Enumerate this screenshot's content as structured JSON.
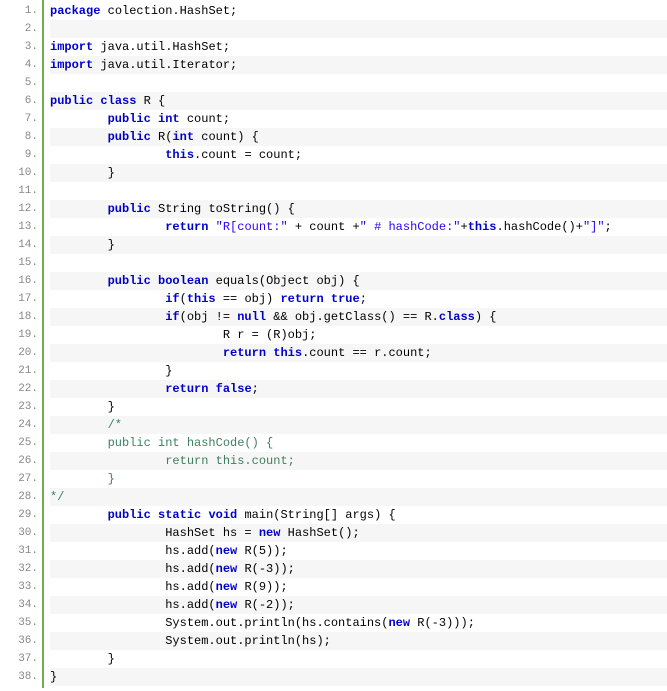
{
  "lines": [
    {
      "num": "1",
      "parts": [
        {
          "cls": "kw",
          "t": "package"
        },
        {
          "cls": "plain",
          "t": " colection.HashSet;"
        }
      ]
    },
    {
      "num": "2",
      "parts": []
    },
    {
      "num": "3",
      "parts": [
        {
          "cls": "kw",
          "t": "import"
        },
        {
          "cls": "plain",
          "t": " java.util.HashSet;"
        }
      ]
    },
    {
      "num": "4",
      "parts": [
        {
          "cls": "kw",
          "t": "import"
        },
        {
          "cls": "plain",
          "t": " java.util.Iterator;"
        }
      ]
    },
    {
      "num": "5",
      "parts": []
    },
    {
      "num": "6",
      "parts": [
        {
          "cls": "kw",
          "t": "public"
        },
        {
          "cls": "plain",
          "t": " "
        },
        {
          "cls": "kw",
          "t": "class"
        },
        {
          "cls": "plain",
          "t": " R {"
        }
      ]
    },
    {
      "num": "7",
      "parts": [
        {
          "cls": "plain",
          "t": "        "
        },
        {
          "cls": "kw",
          "t": "public"
        },
        {
          "cls": "plain",
          "t": " "
        },
        {
          "cls": "kw",
          "t": "int"
        },
        {
          "cls": "plain",
          "t": " count;"
        }
      ]
    },
    {
      "num": "8",
      "parts": [
        {
          "cls": "plain",
          "t": "        "
        },
        {
          "cls": "kw",
          "t": "public"
        },
        {
          "cls": "plain",
          "t": " R("
        },
        {
          "cls": "kw",
          "t": "int"
        },
        {
          "cls": "plain",
          "t": " count) {"
        }
      ]
    },
    {
      "num": "9",
      "parts": [
        {
          "cls": "plain",
          "t": "                "
        },
        {
          "cls": "kw",
          "t": "this"
        },
        {
          "cls": "plain",
          "t": ".count = count;"
        }
      ]
    },
    {
      "num": "10",
      "parts": [
        {
          "cls": "plain",
          "t": "        }"
        }
      ]
    },
    {
      "num": "11",
      "parts": []
    },
    {
      "num": "12",
      "parts": [
        {
          "cls": "plain",
          "t": "        "
        },
        {
          "cls": "kw",
          "t": "public"
        },
        {
          "cls": "plain",
          "t": " String toString() {"
        }
      ]
    },
    {
      "num": "13",
      "parts": [
        {
          "cls": "plain",
          "t": "                "
        },
        {
          "cls": "kw",
          "t": "return"
        },
        {
          "cls": "plain",
          "t": " "
        },
        {
          "cls": "str",
          "t": "\"R[count:\""
        },
        {
          "cls": "plain",
          "t": " + count +"
        },
        {
          "cls": "str",
          "t": "\" # hashCode:\""
        },
        {
          "cls": "plain",
          "t": "+"
        },
        {
          "cls": "kw",
          "t": "this"
        },
        {
          "cls": "plain",
          "t": ".hashCode()+"
        },
        {
          "cls": "str",
          "t": "\"]\""
        },
        {
          "cls": "plain",
          "t": ";"
        }
      ]
    },
    {
      "num": "14",
      "parts": [
        {
          "cls": "plain",
          "t": "        }"
        }
      ]
    },
    {
      "num": "15",
      "parts": []
    },
    {
      "num": "16",
      "parts": [
        {
          "cls": "plain",
          "t": "        "
        },
        {
          "cls": "kw",
          "t": "public"
        },
        {
          "cls": "plain",
          "t": " "
        },
        {
          "cls": "kw",
          "t": "boolean"
        },
        {
          "cls": "plain",
          "t": " equals(Object obj) {"
        }
      ]
    },
    {
      "num": "17",
      "parts": [
        {
          "cls": "plain",
          "t": "                "
        },
        {
          "cls": "kw",
          "t": "if"
        },
        {
          "cls": "plain",
          "t": "("
        },
        {
          "cls": "kw",
          "t": "this"
        },
        {
          "cls": "plain",
          "t": " == obj) "
        },
        {
          "cls": "kw",
          "t": "return"
        },
        {
          "cls": "plain",
          "t": " "
        },
        {
          "cls": "kw",
          "t": "true"
        },
        {
          "cls": "plain",
          "t": ";"
        }
      ]
    },
    {
      "num": "18",
      "parts": [
        {
          "cls": "plain",
          "t": "                "
        },
        {
          "cls": "kw",
          "t": "if"
        },
        {
          "cls": "plain",
          "t": "(obj != "
        },
        {
          "cls": "kw",
          "t": "null"
        },
        {
          "cls": "plain",
          "t": " && obj.getClass() == R."
        },
        {
          "cls": "kw",
          "t": "class"
        },
        {
          "cls": "plain",
          "t": ") {"
        }
      ]
    },
    {
      "num": "19",
      "parts": [
        {
          "cls": "plain",
          "t": "                        R r = (R)obj;"
        }
      ]
    },
    {
      "num": "20",
      "parts": [
        {
          "cls": "plain",
          "t": "                        "
        },
        {
          "cls": "kw",
          "t": "return"
        },
        {
          "cls": "plain",
          "t": " "
        },
        {
          "cls": "kw",
          "t": "this"
        },
        {
          "cls": "plain",
          "t": ".count == r.count;"
        }
      ]
    },
    {
      "num": "21",
      "parts": [
        {
          "cls": "plain",
          "t": "                }"
        }
      ]
    },
    {
      "num": "22",
      "parts": [
        {
          "cls": "plain",
          "t": "                "
        },
        {
          "cls": "kw",
          "t": "return"
        },
        {
          "cls": "plain",
          "t": " "
        },
        {
          "cls": "kw",
          "t": "false"
        },
        {
          "cls": "plain",
          "t": ";"
        }
      ]
    },
    {
      "num": "23",
      "parts": [
        {
          "cls": "plain",
          "t": "        }"
        }
      ]
    },
    {
      "num": "24",
      "parts": [
        {
          "cls": "plain",
          "t": "        "
        },
        {
          "cls": "cmt",
          "t": "/*"
        }
      ]
    },
    {
      "num": "25",
      "parts": [
        {
          "cls": "cmt",
          "t": "        public int hashCode() {"
        }
      ]
    },
    {
      "num": "26",
      "parts": [
        {
          "cls": "cmt",
          "t": "                return this.count;"
        }
      ]
    },
    {
      "num": "27",
      "parts": [
        {
          "cls": "cmt",
          "t": "        }"
        }
      ]
    },
    {
      "num": "28",
      "parts": [
        {
          "cls": "cmt",
          "t": "*/"
        }
      ]
    },
    {
      "num": "29",
      "parts": [
        {
          "cls": "plain",
          "t": "        "
        },
        {
          "cls": "kw",
          "t": "public"
        },
        {
          "cls": "plain",
          "t": " "
        },
        {
          "cls": "kw",
          "t": "static"
        },
        {
          "cls": "plain",
          "t": " "
        },
        {
          "cls": "kw",
          "t": "void"
        },
        {
          "cls": "plain",
          "t": " main(String[] args) {"
        }
      ]
    },
    {
      "num": "30",
      "parts": [
        {
          "cls": "plain",
          "t": "                HashSet hs = "
        },
        {
          "cls": "kw",
          "t": "new"
        },
        {
          "cls": "plain",
          "t": " HashSet();"
        }
      ]
    },
    {
      "num": "31",
      "parts": [
        {
          "cls": "plain",
          "t": "                hs.add("
        },
        {
          "cls": "kw",
          "t": "new"
        },
        {
          "cls": "plain",
          "t": " R(5));"
        }
      ]
    },
    {
      "num": "32",
      "parts": [
        {
          "cls": "plain",
          "t": "                hs.add("
        },
        {
          "cls": "kw",
          "t": "new"
        },
        {
          "cls": "plain",
          "t": " R(-3));"
        }
      ]
    },
    {
      "num": "33",
      "parts": [
        {
          "cls": "plain",
          "t": "                hs.add("
        },
        {
          "cls": "kw",
          "t": "new"
        },
        {
          "cls": "plain",
          "t": " R(9));"
        }
      ]
    },
    {
      "num": "34",
      "parts": [
        {
          "cls": "plain",
          "t": "                hs.add("
        },
        {
          "cls": "kw",
          "t": "new"
        },
        {
          "cls": "plain",
          "t": " R(-2));"
        }
      ]
    },
    {
      "num": "35",
      "parts": [
        {
          "cls": "plain",
          "t": "                System.out.println(hs.contains("
        },
        {
          "cls": "kw",
          "t": "new"
        },
        {
          "cls": "plain",
          "t": " R(-3)));"
        }
      ]
    },
    {
      "num": "36",
      "parts": [
        {
          "cls": "plain",
          "t": "                System.out.println(hs);"
        }
      ]
    },
    {
      "num": "37",
      "parts": [
        {
          "cls": "plain",
          "t": "        }"
        }
      ]
    },
    {
      "num": "38",
      "parts": [
        {
          "cls": "plain",
          "t": "}"
        }
      ]
    }
  ]
}
